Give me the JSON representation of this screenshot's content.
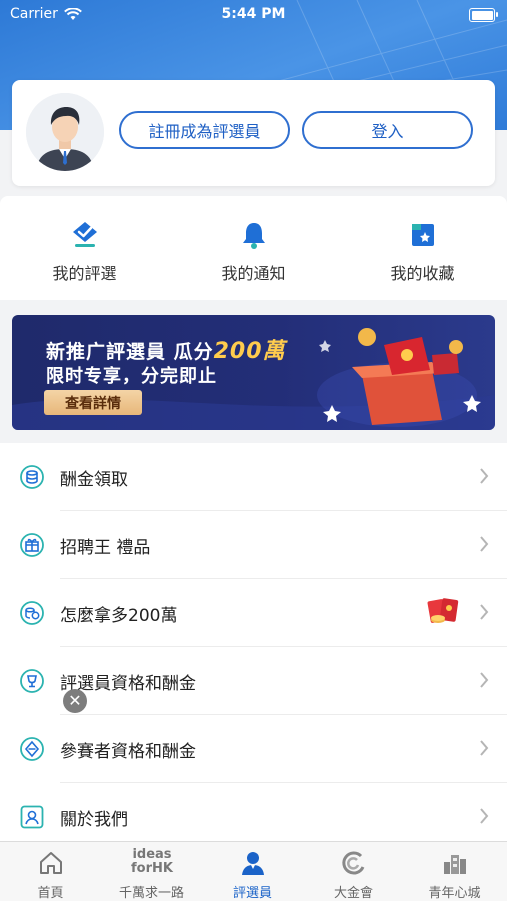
{
  "status_bar": {
    "carrier": "Carrier",
    "time": "5:44 PM"
  },
  "account": {
    "register_label": "註冊成為評選員",
    "login_label": "登入"
  },
  "quick_actions": [
    {
      "label": "我的評選",
      "icon": "check-badge-icon"
    },
    {
      "label": "我的通知",
      "icon": "bell-icon"
    },
    {
      "label": "我的收藏",
      "icon": "bookmark-star-icon"
    }
  ],
  "banner": {
    "title_prefix": "新推广評選員 瓜分",
    "title_amount": "200萬",
    "subtitle": "限时专享，分完即止",
    "cta_label": "查看詳情"
  },
  "menu": [
    {
      "label": "酬金領取",
      "icon": "coins-icon"
    },
    {
      "label": "招聘王 禮品",
      "icon": "gift-icon"
    },
    {
      "label": "怎麼拿多200萬",
      "icon": "coin-stack-icon",
      "has_red_packet": true
    },
    {
      "label": "評選員資格和酬金",
      "icon": "trophy-icon"
    },
    {
      "label": "參賽者資格和酬金",
      "icon": "diamond-icon"
    },
    {
      "label": "關於我們",
      "icon": "person-card-icon"
    }
  ],
  "tabbar": [
    {
      "label": "首頁",
      "icon": "home-icon",
      "active": false
    },
    {
      "label": "千萬求一路",
      "icon": "ideas-for-hk-logo",
      "logo_text_1": "ideas",
      "logo_text_2": "forHK",
      "active": false
    },
    {
      "label": "評選員",
      "icon": "judge-person-icon",
      "active": true
    },
    {
      "label": "大金會",
      "icon": "swirl-logo-icon",
      "active": false
    },
    {
      "label": "青年心城",
      "icon": "city-icon",
      "active": false
    }
  ],
  "colors": {
    "primary": "#1b63c8",
    "hero": "#2f7bd8",
    "banner_bg": "#1f2a6b",
    "accent_gold": "#ffcc4d"
  }
}
